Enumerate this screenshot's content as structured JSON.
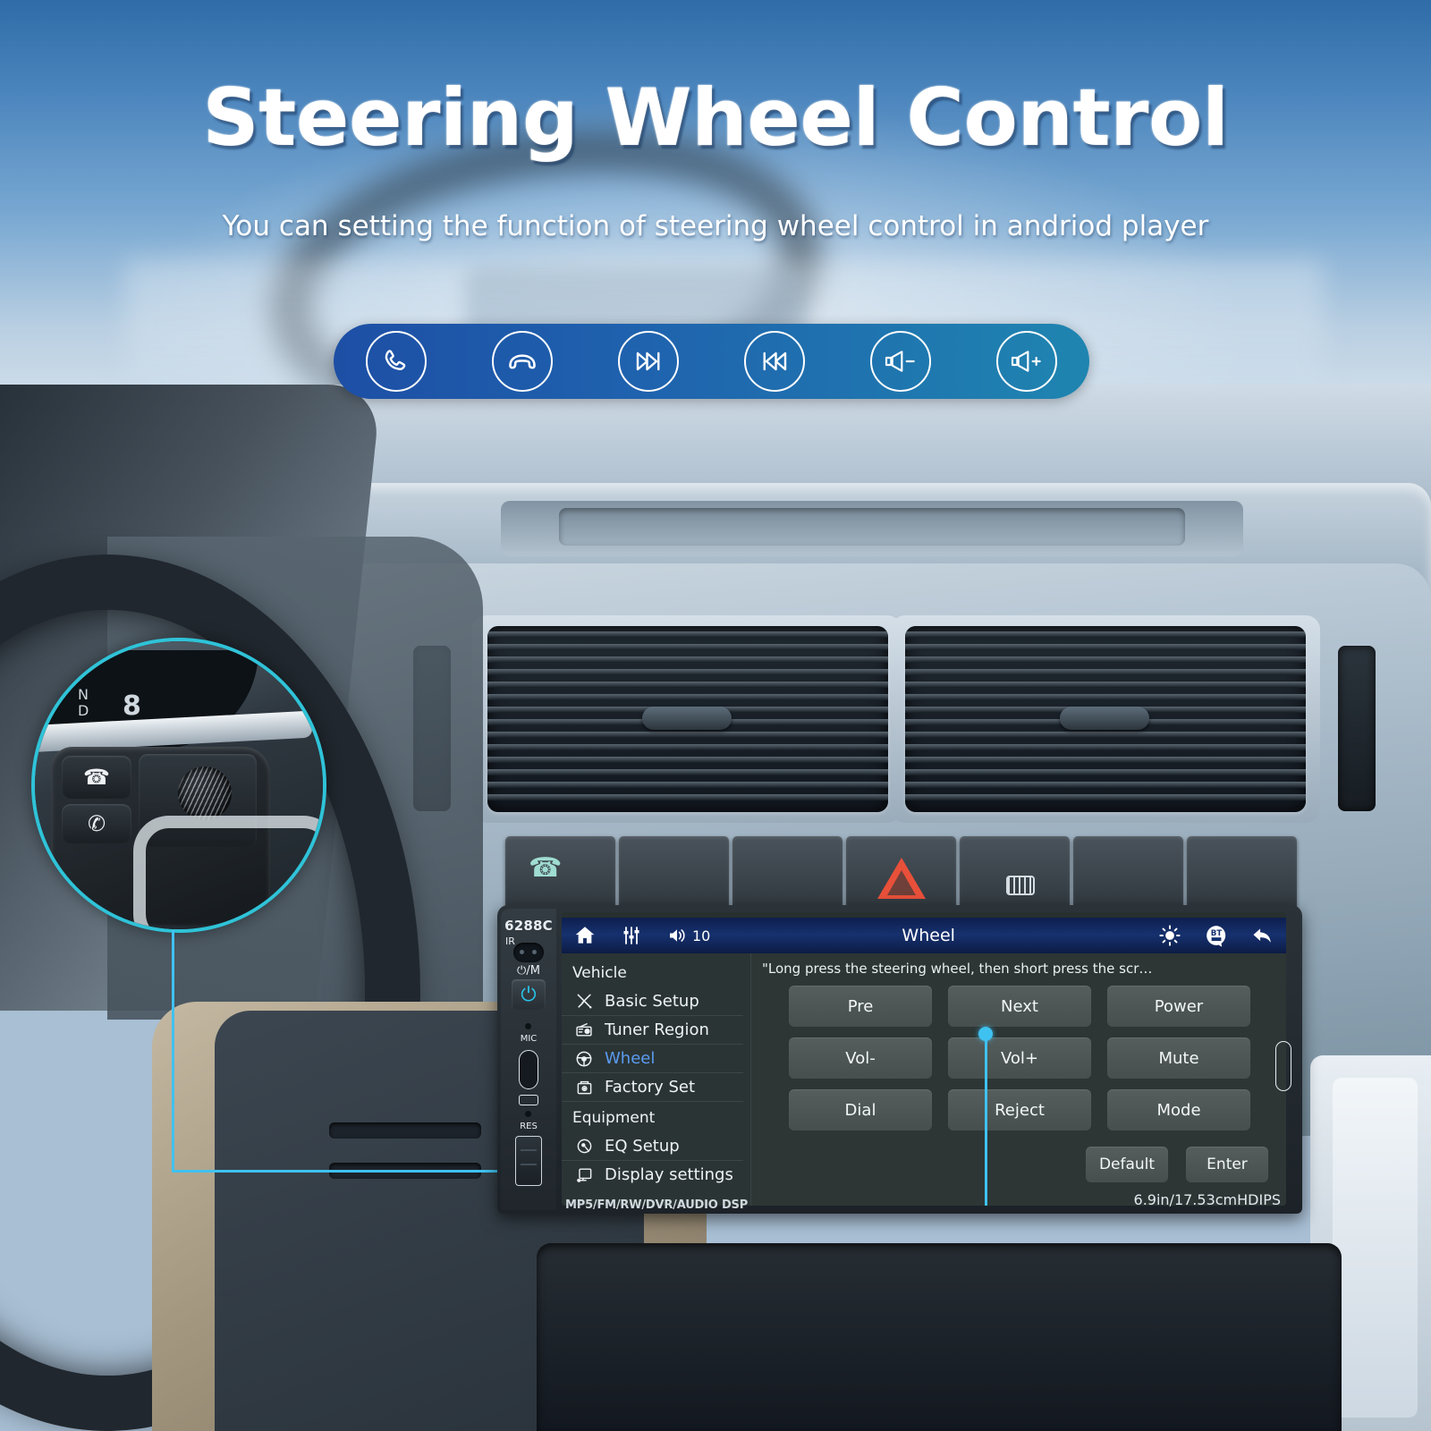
{
  "hero": {
    "title": "Steering Wheel Control",
    "subtitle": "You can setting the function of steering wheel control in andriod player"
  },
  "pill_icons": [
    {
      "name": "answer-call-icon",
      "label": "Answer call"
    },
    {
      "name": "end-call-icon",
      "label": "End call"
    },
    {
      "name": "next-track-icon",
      "label": "Next track"
    },
    {
      "name": "previous-track-icon",
      "label": "Previous track"
    },
    {
      "name": "volume-down-icon",
      "label": "Volume down"
    },
    {
      "name": "volume-up-icon",
      "label": "Volume up"
    }
  ],
  "callout": {
    "gear_n": "N",
    "gear_d": "D",
    "gear_num": "8"
  },
  "head_unit": {
    "model": "6288C",
    "ir_label": "IR",
    "power_label": "⏻/M",
    "mic_label": "MIC",
    "res_label": "RES",
    "footer_left": "MP5/FM/RW/DVR/AUDIO DSP",
    "footer_right": "6.9in/17.53cmHDIPS"
  },
  "screen": {
    "header": {
      "home_icon": "home-icon",
      "eq_icon": "equalizer-icon",
      "volume_icon": "volume-icon",
      "volume_value": "10",
      "title": "Wheel",
      "brightness_icon": "brightness-icon",
      "bluetooth_icon": "bluetooth-icon",
      "back_icon": "back-arrow-icon"
    },
    "sidebar": [
      {
        "type": "group",
        "label": "Vehicle"
      },
      {
        "type": "item",
        "label": "Basic Setup",
        "icon": "tools-icon",
        "active": false
      },
      {
        "type": "item",
        "label": "Tuner Region",
        "icon": "radio-icon",
        "active": false
      },
      {
        "type": "item",
        "label": "Wheel",
        "icon": "steering-wheel-icon",
        "active": true
      },
      {
        "type": "item",
        "label": "Factory Set",
        "icon": "factory-icon",
        "active": false
      },
      {
        "type": "group",
        "label": "Equipment"
      },
      {
        "type": "item",
        "label": "EQ Setup",
        "icon": "eq-dial-icon",
        "active": false
      },
      {
        "type": "item",
        "label": "Display settings",
        "icon": "monitor-icon",
        "active": false
      }
    ],
    "hint": "\"Long press the steering wheel, then short press the scr…",
    "buttons": [
      "Pre",
      "Next",
      "Power",
      "Vol-",
      "Vol+",
      "Mute",
      "Dial",
      "Reject",
      "Mode"
    ],
    "footer_buttons": [
      "Default",
      "Enter"
    ]
  },
  "colors": {
    "accent_cyan": "#3fc2f0",
    "pill_blue_start": "#1d4fa5",
    "pill_blue_end": "#1f85b0",
    "screen_header_blue": "#16316f",
    "active_item_blue": "#5a9bf0",
    "hazard_red": "#e8503a"
  }
}
